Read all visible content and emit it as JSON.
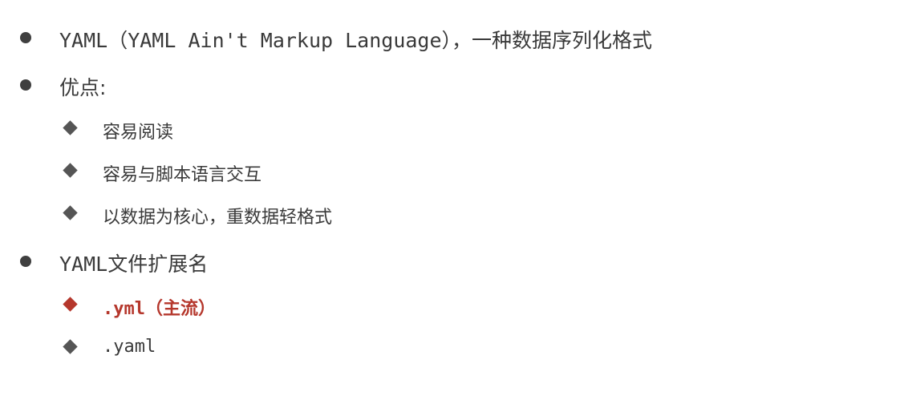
{
  "bullets": {
    "item1": {
      "text": "YAML（YAML Ain't Markup Language），一种数据序列化格式"
    },
    "item2": {
      "text": "优点:",
      "sub": [
        {
          "text": "容易阅读"
        },
        {
          "text": "容易与脚本语言交互"
        },
        {
          "text": "以数据为核心，重数据轻格式"
        }
      ]
    },
    "item3": {
      "text": "YAML文件扩展名",
      "sub": [
        {
          "text": ".yml（主流）",
          "accent": true
        },
        {
          "text": ".yaml"
        }
      ]
    }
  },
  "colors": {
    "text": "#3a3a3a",
    "bullet": "#3f3f3f",
    "diamond": "#555555",
    "accent": "#b5372c"
  }
}
